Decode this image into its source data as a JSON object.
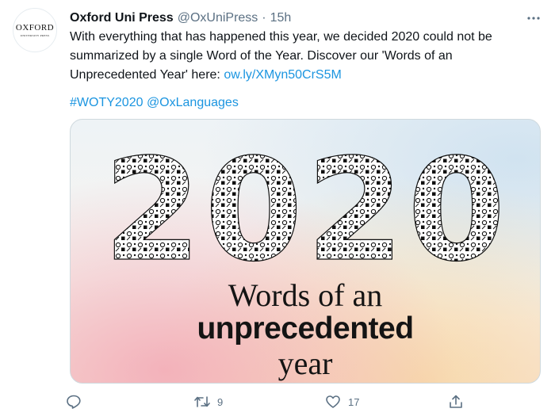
{
  "tweet": {
    "author_name": "Oxford Uni Press",
    "handle": "@OxUniPress",
    "separator": "·",
    "time": "15h",
    "avatar": {
      "logo_main": "OXFORD",
      "logo_sub": "UNIVERSITY PRESS"
    },
    "body_text": "With everything that has happened this year, we decided 2020 could not be summarized by a single Word of the Year. Discover our 'Words of an Unprecedented Year' here: ",
    "link": "ow.ly/XMyn50CrS5M",
    "hashtag": "#WOTY2020",
    "mention": "@OxLanguages",
    "media": {
      "headline": "2020",
      "caption_line1": "Words of an",
      "caption_line2": "unprecedented",
      "caption_line3": "year"
    },
    "actions": {
      "reply_count": "",
      "retweet_count": "9",
      "like_count": "17"
    }
  },
  "icons": [
    "more-icon",
    "reply-icon",
    "retweet-icon",
    "like-icon",
    "share-icon"
  ],
  "colors": {
    "link": "#1b95e0",
    "secondary": "#5b7083",
    "text": "#0f1419",
    "border": "#cfd9de"
  }
}
